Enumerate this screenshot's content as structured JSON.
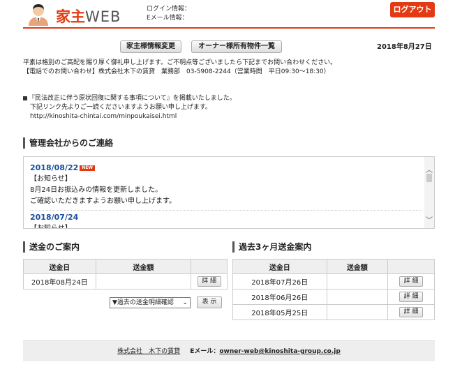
{
  "header": {
    "logo_kanji": "家主",
    "logo_web": "WEB",
    "login_info_label": "ログイン情報：",
    "email_info_label": "Eメール情報：",
    "logout_label": "ログアウト"
  },
  "toolbar": {
    "edit_owner_label": "家主様情報変更",
    "property_list_label": "オーナー様所有物件一覧",
    "current_date": "2018年8月27日"
  },
  "notice": {
    "line1": "平素は格別のご高配を賜り厚く御礼申し上げます。ご不明点等ございましたら下記までお問い合わせください。",
    "line2": "【電話でのお問い合わせ】株式会社木下の賃貸　業務部　03-5908-2244（営業時間　平日09:30～18:30）"
  },
  "announcement": {
    "line1": "『民法改正に伴う原状回復に関する事項について』を掲載いたしました。",
    "line2": "下記リンク先よりご一読くださいますようお願い申し上げます。",
    "link": "http://kinoshita-chintai.com/minpoukaisei.html"
  },
  "news": {
    "title": "管理会社からのご連絡",
    "new_badge": "NEW",
    "items": [
      {
        "date": "2018/08/22",
        "heading": "【お知らせ】",
        "body1": "8月24日お振込みの情報を更新しました。",
        "body2": "ご確認いただきますようお願い申し上げます。"
      },
      {
        "date": "2018/07/24",
        "heading": "【お知らせ】"
      }
    ]
  },
  "remittance": {
    "title": "送金のご案内",
    "col_date": "送金日",
    "col_amount": "送金額",
    "rows": [
      {
        "date": "2018年08月24日",
        "amount": "",
        "detail": "詳 細"
      }
    ],
    "select_value": "▼過去の送金明細確認",
    "show_label": "表 示"
  },
  "past_remittance": {
    "title": "過去3ヶ月送金案内",
    "col_date": "送金日",
    "col_amount": "送金額",
    "rows": [
      {
        "date": "2018年07月26日",
        "amount": "",
        "detail": "詳 細"
      },
      {
        "date": "2018年06月26日",
        "amount": "",
        "detail": "詳 細"
      },
      {
        "date": "2018年05月25日",
        "amount": "",
        "detail": "詳 細"
      }
    ]
  },
  "footer": {
    "company": "株式会社　木下の賃貸",
    "email_label": "Eメール：",
    "email": "owner-web@kinoshita-group.co.jp"
  },
  "colors": {
    "accent": "#e33a14",
    "news_date": "#1a4fa0",
    "table_header": "#efefef"
  }
}
